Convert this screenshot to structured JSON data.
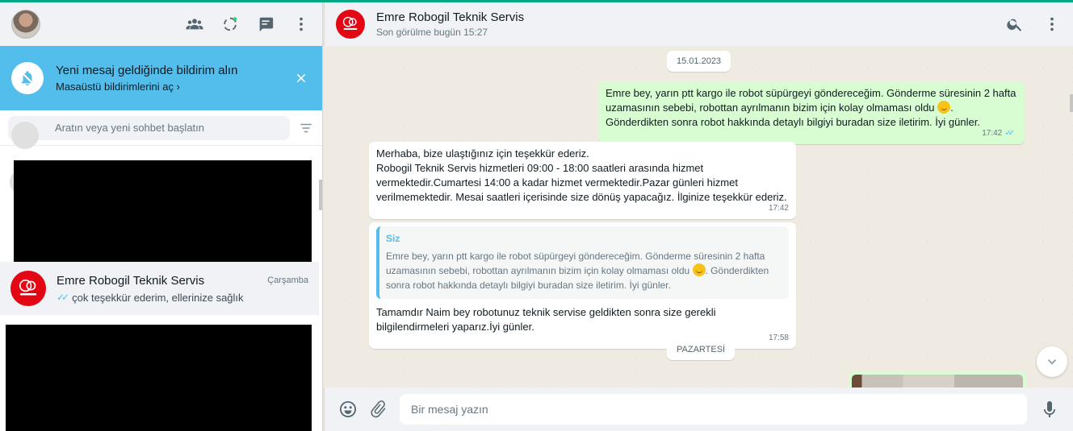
{
  "left": {
    "notification": {
      "title": "Yeni mesaj geldiğinde bildirim alın",
      "subtitle": "Masaüstü bildirimlerini aç ›"
    },
    "search": {
      "placeholder": "Aratın veya yeni sohbet başlatın"
    },
    "chats": [
      {
        "name": "Emre Robogil Teknik Servis",
        "time": "Çarşamba",
        "preview": "çok teşekkür ederim, ellerinize sağlık",
        "ticks": "✓✓"
      }
    ]
  },
  "chat": {
    "header": {
      "name": "Emre Robogil Teknik Servis",
      "status": "Son görülme bugün 15:27"
    },
    "dates": [
      "15.01.2023",
      "PAZARTESİ"
    ],
    "messages": [
      {
        "direction": "out",
        "text_a": "Emre bey, yarın ptt kargo ile robot süpürgeyi göndereceğim. Gönderme süresinin 2 hafta uzamasının sebebi, robottan ayrılmanın bizim için kolay olmaması oldu ",
        "text_b": ". Gönderdikten sonra robot hakkında detaylı bilgiyi buradan size iletirim. İyi günler.",
        "time": "17:42",
        "ticks": "✓✓"
      },
      {
        "direction": "in",
        "line1": "Merhaba, bize ulaştığınız için teşekkür ederiz.",
        "line2": "Robogil Teknik Servis hizmetleri 09:00 - 18:00 saatleri arasında hizmet vermektedir.Cumartesi 14:00 a kadar hizmet vermektedir.Pazar günleri hizmet verilmemektedir. Mesai saatleri içerisinde size dönüş yapacağız. İlginize teşekkür ederiz.",
        "time": "17:42"
      },
      {
        "direction": "in",
        "quote_author": "Siz",
        "quote_a": "Emre bey, yarın ptt kargo ile robot süpürgeyi göndereceğim. Gönderme süresinin 2 hafta uzamasının sebebi, robottan ayrılmanın bizim için kolay olmaması oldu ",
        "quote_b": ". Gönderdikten sonra robot hakkında detaylı bilgiyi buradan size iletirim. İyi günler.",
        "text": "Tamamdır Naim bey robotunuz teknik servise geldikten sonra size gerekli bilgilendirmeleri yaparız.İyi günler.",
        "time": "17:58"
      }
    ],
    "composer": {
      "placeholder": "Bir mesaj yazın"
    }
  },
  "icons": [
    "communities-icon",
    "status-icon",
    "new-chat-icon",
    "menu-icon",
    "bell-off-icon",
    "close-icon",
    "search-icon",
    "filter-icon",
    "emoji-icon",
    "attach-icon",
    "mic-icon",
    "chevron-down-icon"
  ],
  "colors": {
    "accent": "#00a884",
    "notification": "#53bdeb",
    "outgoing_bubble": "#d9fdd3",
    "brand_red": "#e30613"
  }
}
